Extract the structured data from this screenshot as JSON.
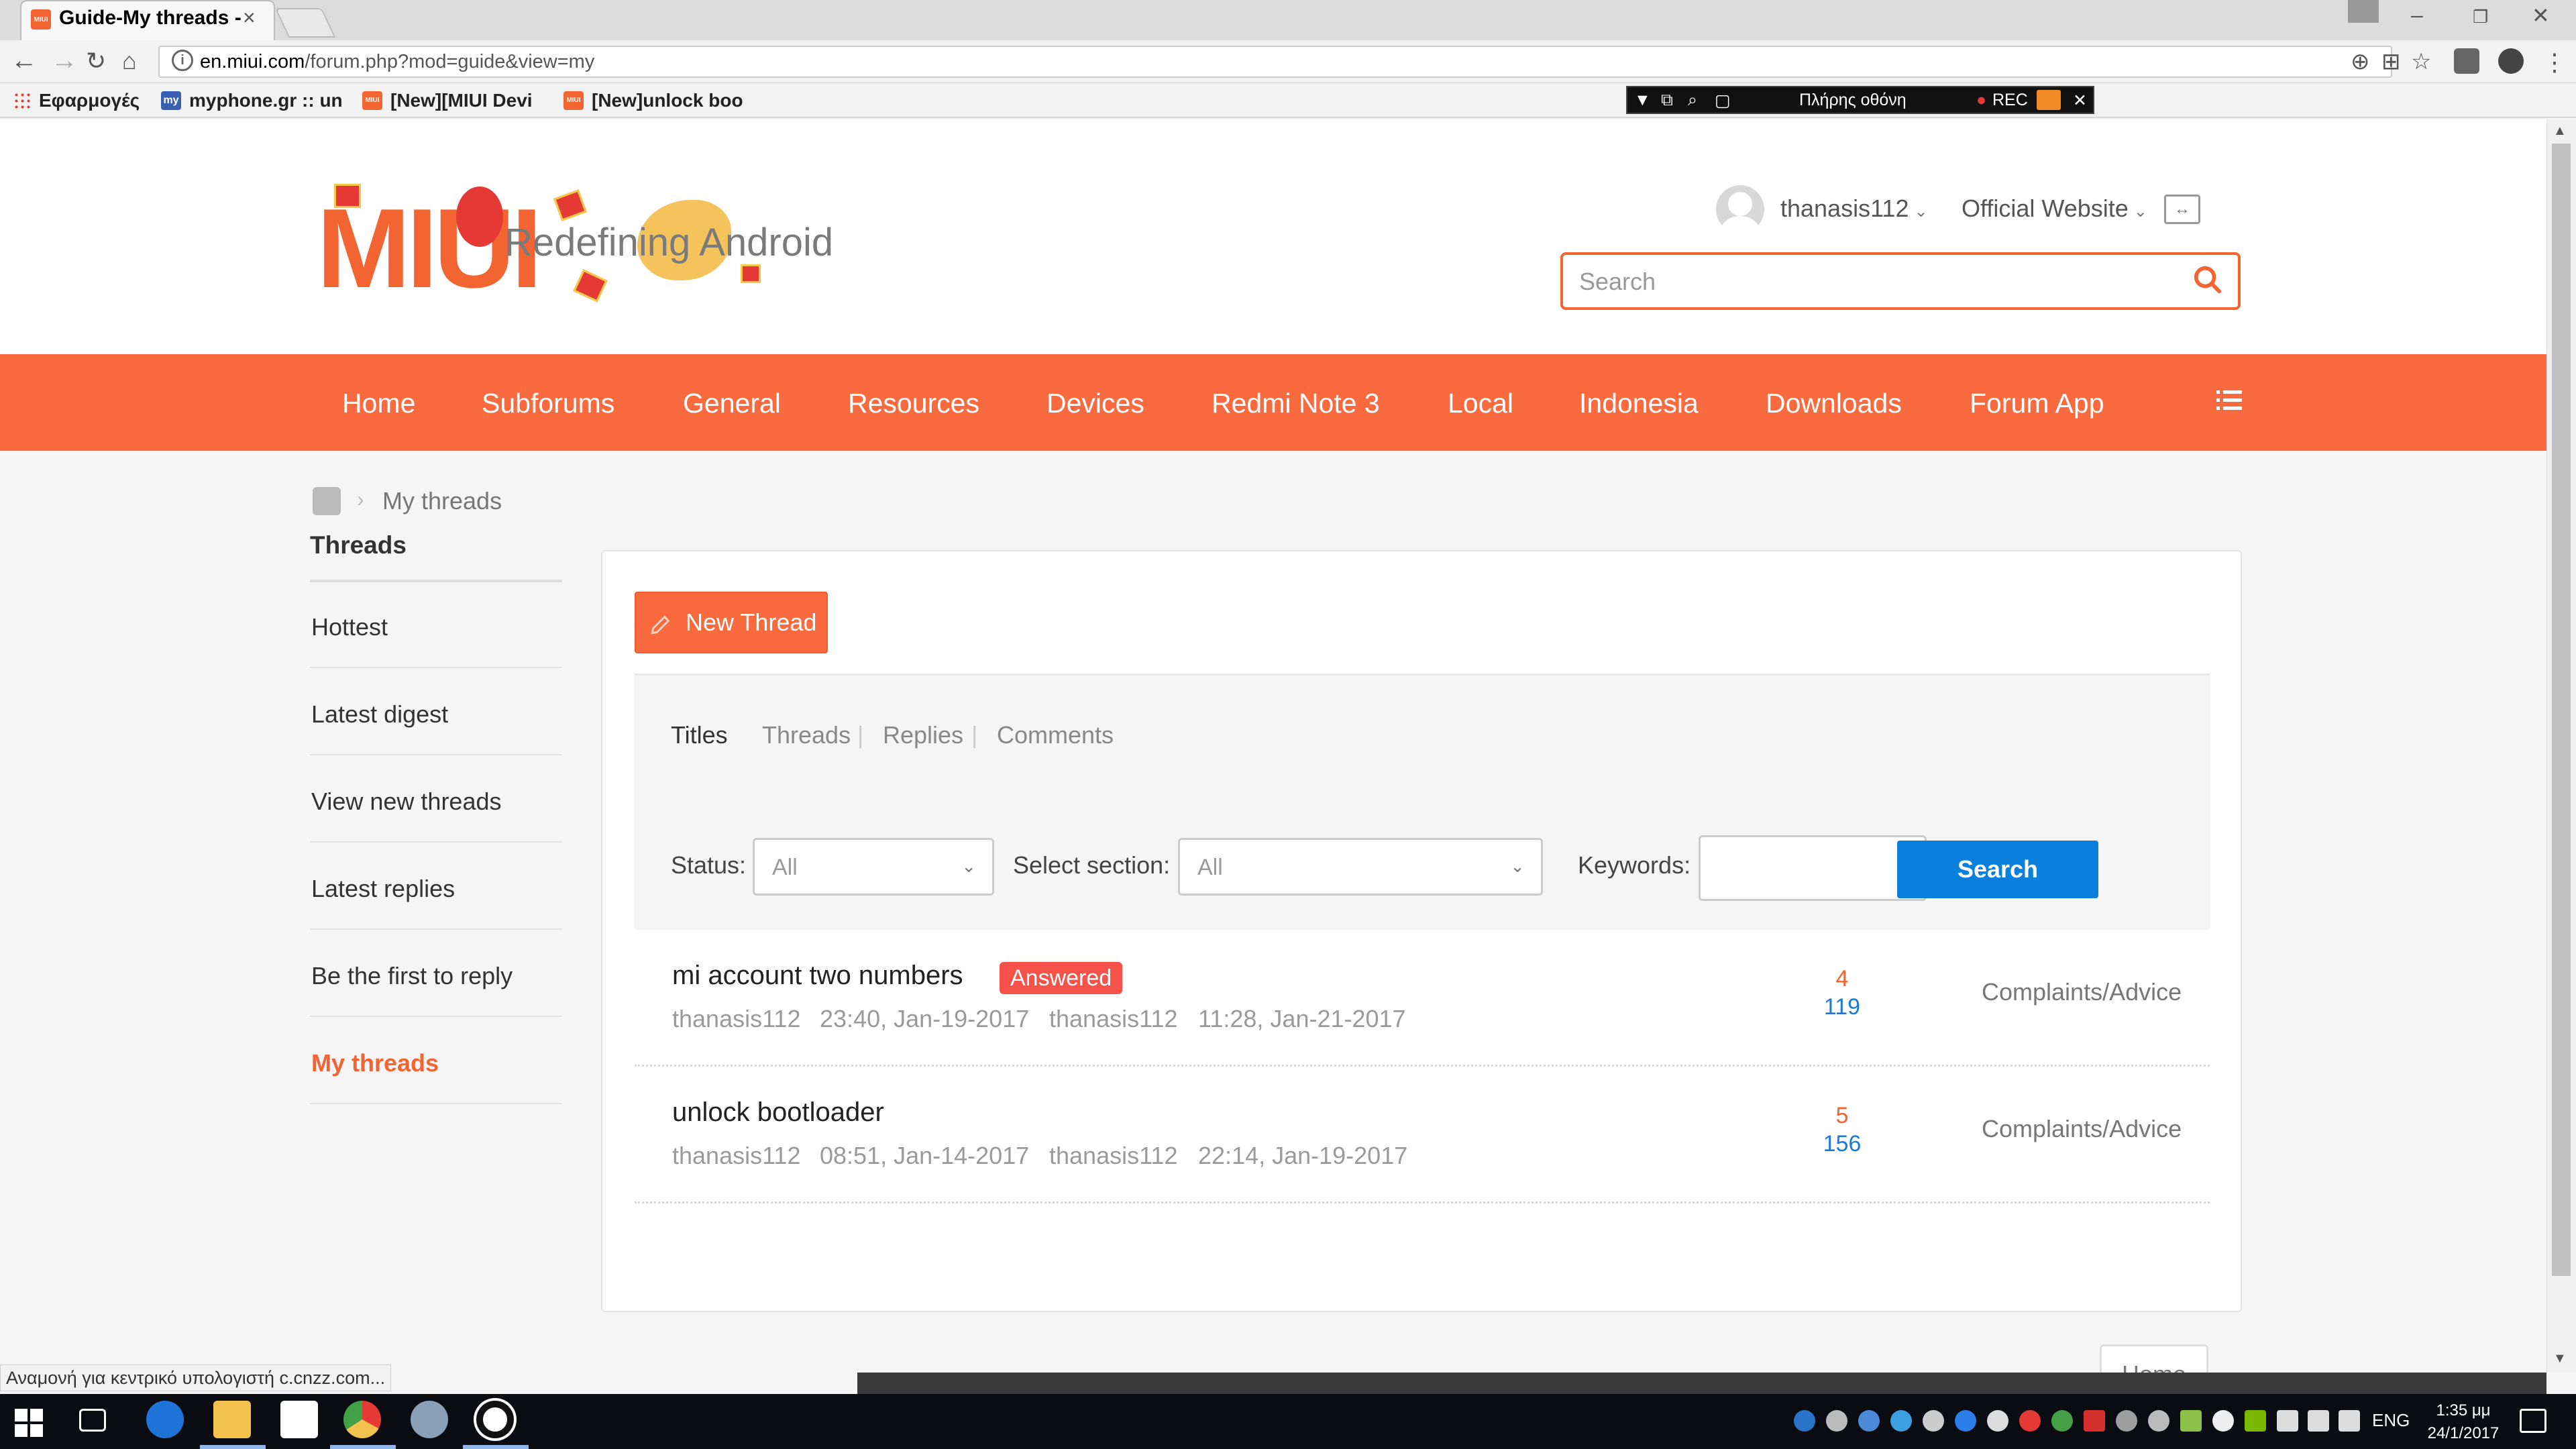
{
  "browser": {
    "tab_title": "Guide-My threads -",
    "tab_close": "×",
    "favicon_text": "MIUI",
    "url_host": "en.miui.com",
    "url_path": "/forum.php?mod=guide&view=my",
    "bookmarks": [
      {
        "label": "Εφαρμογές",
        "icon": "apps-grid-icon"
      },
      {
        "label": "myphone.gr :: un",
        "icon": "myphone-favicon",
        "favicon_text": "my"
      },
      {
        "label": "[New][MIUI Devi",
        "icon": "miui-favicon",
        "favicon_text": "MIUI"
      },
      {
        "label": "[New]unlock boo",
        "icon": "miui-favicon",
        "favicon_text": "MIUI"
      }
    ],
    "recorder_fullscreen_label": "Πλήρης οθόνη",
    "recorder_rec_label": "REC",
    "status_tip": "Αναμονή για κεντρικό υπολογιστή c.cnzz.com..."
  },
  "header": {
    "logo_text": "MIUI",
    "tagline": "Redefining Android",
    "username": "thanasis112",
    "official_website": "Official Website",
    "search_placeholder": "Search"
  },
  "nav": {
    "items": [
      "Home",
      "Subforums",
      "General",
      "Resources",
      "Devices",
      "Redmi Note 3",
      "Local",
      "Indonesia",
      "Downloads",
      "Forum App"
    ],
    "accent_color": "#fa6a3f"
  },
  "breadcrumb": {
    "current": "My threads"
  },
  "sidebar": {
    "title": "Threads",
    "items": [
      "Hottest",
      "Latest digest",
      "View new threads",
      "Latest replies",
      "Be the first to reply",
      "My threads"
    ],
    "active_index": 5
  },
  "content": {
    "new_thread_label": "New Thread",
    "tabs": [
      "Titles",
      "Threads",
      "Replies",
      "Comments"
    ],
    "active_tab": 0,
    "status_label": "Status:",
    "status_value": "All",
    "section_label": "Select section:",
    "section_value": "All",
    "keywords_label": "Keywords:",
    "keywords_value": "",
    "search_button": "Search",
    "threads": [
      {
        "title": "mi account two numbers",
        "badge": "Answered",
        "author": "thanasis112",
        "created": "23:40, Jan-19-2017",
        "last_poster": "thanasis112",
        "last_post": "11:28, Jan-21-2017",
        "replies": "4",
        "views": "119",
        "section": "Complaints/Advice"
      },
      {
        "title": "unlock bootloader",
        "badge": "",
        "author": "thanasis112",
        "created": "08:51, Jan-14-2017",
        "last_poster": "thanasis112",
        "last_post": "22:14, Jan-19-2017",
        "replies": "5",
        "views": "156",
        "section": "Complaints/Advice"
      }
    ],
    "home_button": "Home"
  },
  "taskbar": {
    "language": "ENG",
    "time": "1:35 μμ",
    "date": "24/1/2017"
  }
}
